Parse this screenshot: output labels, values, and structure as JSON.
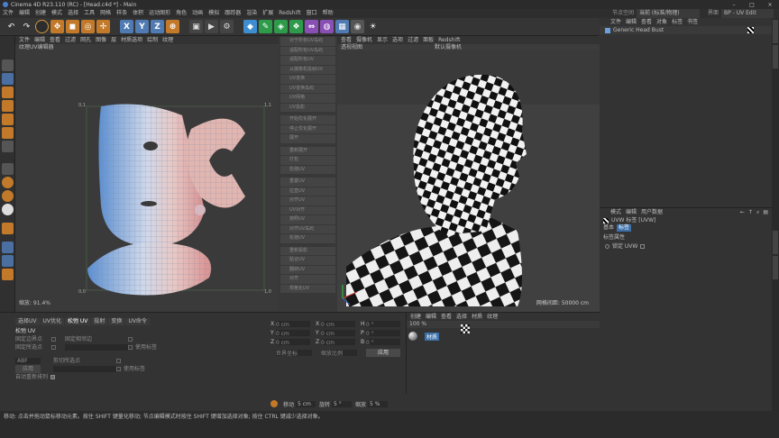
{
  "title": "Cinema 4D R23.110 (RC) - [Head.c4d *] - Main",
  "window_controls": {
    "min": "–",
    "max": "□",
    "close": "×"
  },
  "menu": [
    "文件",
    "编辑",
    "创建",
    "模式",
    "选择",
    "工具",
    "网格",
    "样条",
    "体积",
    "运动图形",
    "角色",
    "动画",
    "模拟",
    "跟踪器",
    "渲染",
    "扩展",
    "Redshift",
    "窗口",
    "帮助"
  ],
  "node_space": {
    "label": "节点空间",
    "value": "当前 (标准/物理)"
  },
  "layout": {
    "label": "界面",
    "value": "BP - UV Edit"
  },
  "uv_editor": {
    "menu": [
      "文件",
      "编辑",
      "查看",
      "过滤",
      "网孔",
      "图像",
      "层",
      "材质选项",
      "绘制",
      "纹理"
    ],
    "title": "纹理UV编辑器",
    "coord_top_left": "0,1",
    "coord_top_right": "1,1",
    "coord_bottom_left": "0,0",
    "coord_bottom_right": "1,0",
    "zoom": "缩放: 91.4%"
  },
  "mid_buttons": [
    "对于所有UV岛屿",
    "适配所有UV岛屿",
    "适配所有UV",
    "从摄像机投射UV",
    "UV变换",
    "UV变换岛屿",
    "UV网格",
    "UV投影",
    "开始优化展开",
    "停止优化展开",
    "展开",
    "重新展开",
    "打包",
    "松弛UV",
    "重置UV",
    "拉直UV",
    "对齐UV",
    "UV对齐",
    "按照UV",
    "对齐UV岛屿",
    "松弛UV",
    "重新投影",
    "贴合UV",
    "翻转UV",
    "对齐",
    "规格化UV",
    "伸缩",
    "翻转",
    "清理UV",
    "镜像UV",
    "剪切"
  ],
  "viewport": {
    "menu": [
      "查看",
      "摄像机",
      "显示",
      "选项",
      "过滤",
      "面板",
      "Redshift"
    ],
    "title": "透视视图",
    "camera": "默认摄像机",
    "grid": "网格间距: 50000 cm"
  },
  "object_manager": {
    "menu": [
      "文件",
      "编辑",
      "查看",
      "对象",
      "标签",
      "书签"
    ],
    "object": "Generic Head Bust"
  },
  "attributes": {
    "menu": [
      "模式",
      "编辑",
      "用户数据"
    ],
    "tag": "UVW 标签 [UVW]",
    "tabs": [
      "基本",
      "标签"
    ],
    "section": "标签属性",
    "lock_label": "锁定 UVW"
  },
  "uv_tools": {
    "tabs": [
      "选择UV",
      "UV优化",
      "松弛 UV",
      "投射",
      "变换",
      "UV命令"
    ],
    "section": "松弛 UV",
    "rows": [
      "固定边界点",
      "固定相邻边",
      "固定所选点",
      "剪切所选点",
      "使用标签",
      "使用标签"
    ],
    "sel": "ABF",
    "apply": "应用",
    "auto": "自动重新排列"
  },
  "coords": {
    "labels": [
      "X",
      "Y",
      "Z",
      "X",
      "Y",
      "Z",
      "H",
      "P",
      "B"
    ],
    "values": [
      "0 cm",
      "0 cm",
      "0 cm",
      "0 cm",
      "0 cm",
      "0 cm",
      "0 °",
      "0 °",
      "0 °"
    ],
    "mode1": "世界坐标",
    "mode2": "缩放比例",
    "apply": "应用"
  },
  "material_manager": {
    "menu": [
      "创建",
      "编辑",
      "查看",
      "选择",
      "材质",
      "纹理"
    ],
    "zoom": "100 %",
    "mat_name": "材质"
  },
  "bottom_tools": {
    "move_label": "移动",
    "move_val": "5 cm",
    "rot_label": "旋转",
    "rot_val": "5 °",
    "scale_label": "缩放",
    "scale_val": "5 %"
  },
  "status": "移动: 点击并拖动鼠标移动元素。按住 SHIFT 键量化移动; 节点编辑模式时按住 SHIFT 键增加选择对象; 按住 CTRL 键减少选择对象。"
}
